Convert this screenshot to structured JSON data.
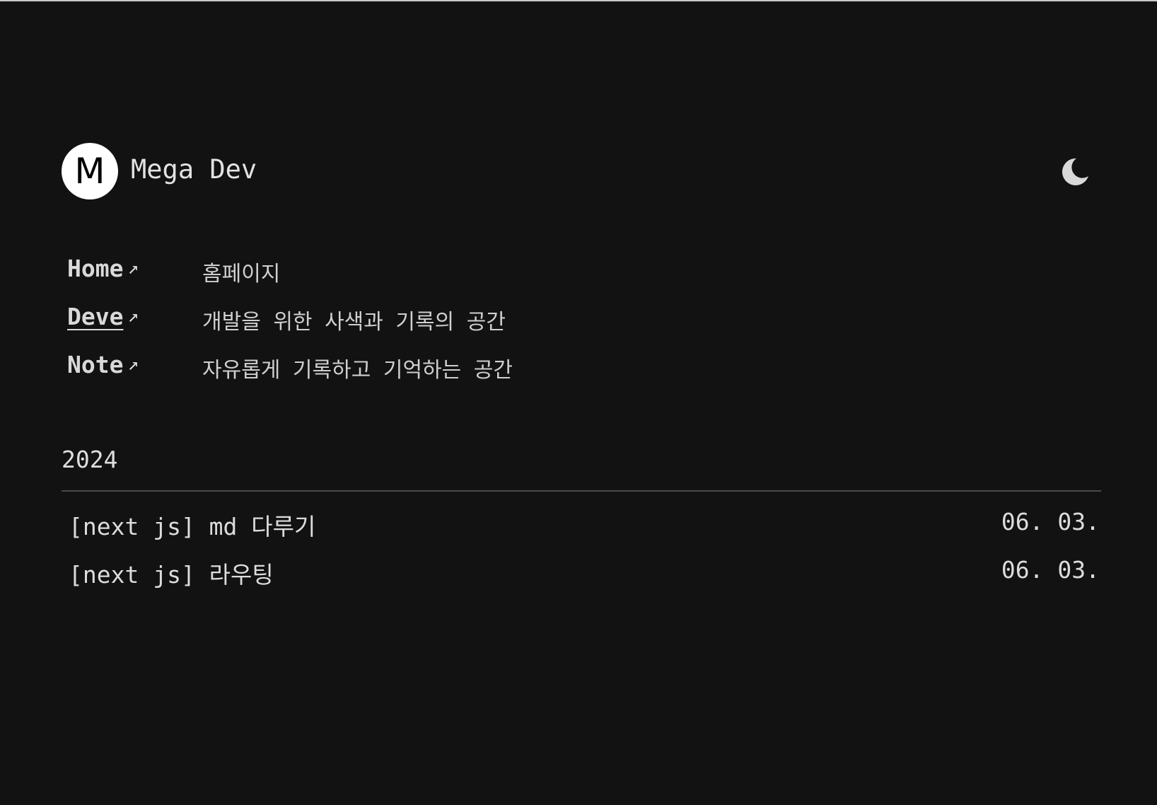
{
  "site": {
    "logo_letter": "M",
    "title": "Mega Dev",
    "theme_icon": "moon-icon"
  },
  "nav": {
    "items": [
      {
        "label": "Home",
        "arrow": "↗",
        "description": "홈페이지",
        "active": false
      },
      {
        "label": "Deve",
        "arrow": "↗",
        "description": "개발을 위한 사색과 기록의 공간",
        "active": true
      },
      {
        "label": "Note",
        "arrow": "↗",
        "description": "자유롭게 기록하고 기억하는 공간",
        "active": false
      }
    ]
  },
  "posts": {
    "year": "2024",
    "items": [
      {
        "title": "[next js] md 다루기",
        "date": "06. 03."
      },
      {
        "title": "[next js] 라우팅",
        "date": "06. 03."
      }
    ]
  },
  "colors": {
    "background": "#121212",
    "text": "#d6d6d6",
    "logo_bg": "#ffffff",
    "divider": "#4a4a4a"
  }
}
